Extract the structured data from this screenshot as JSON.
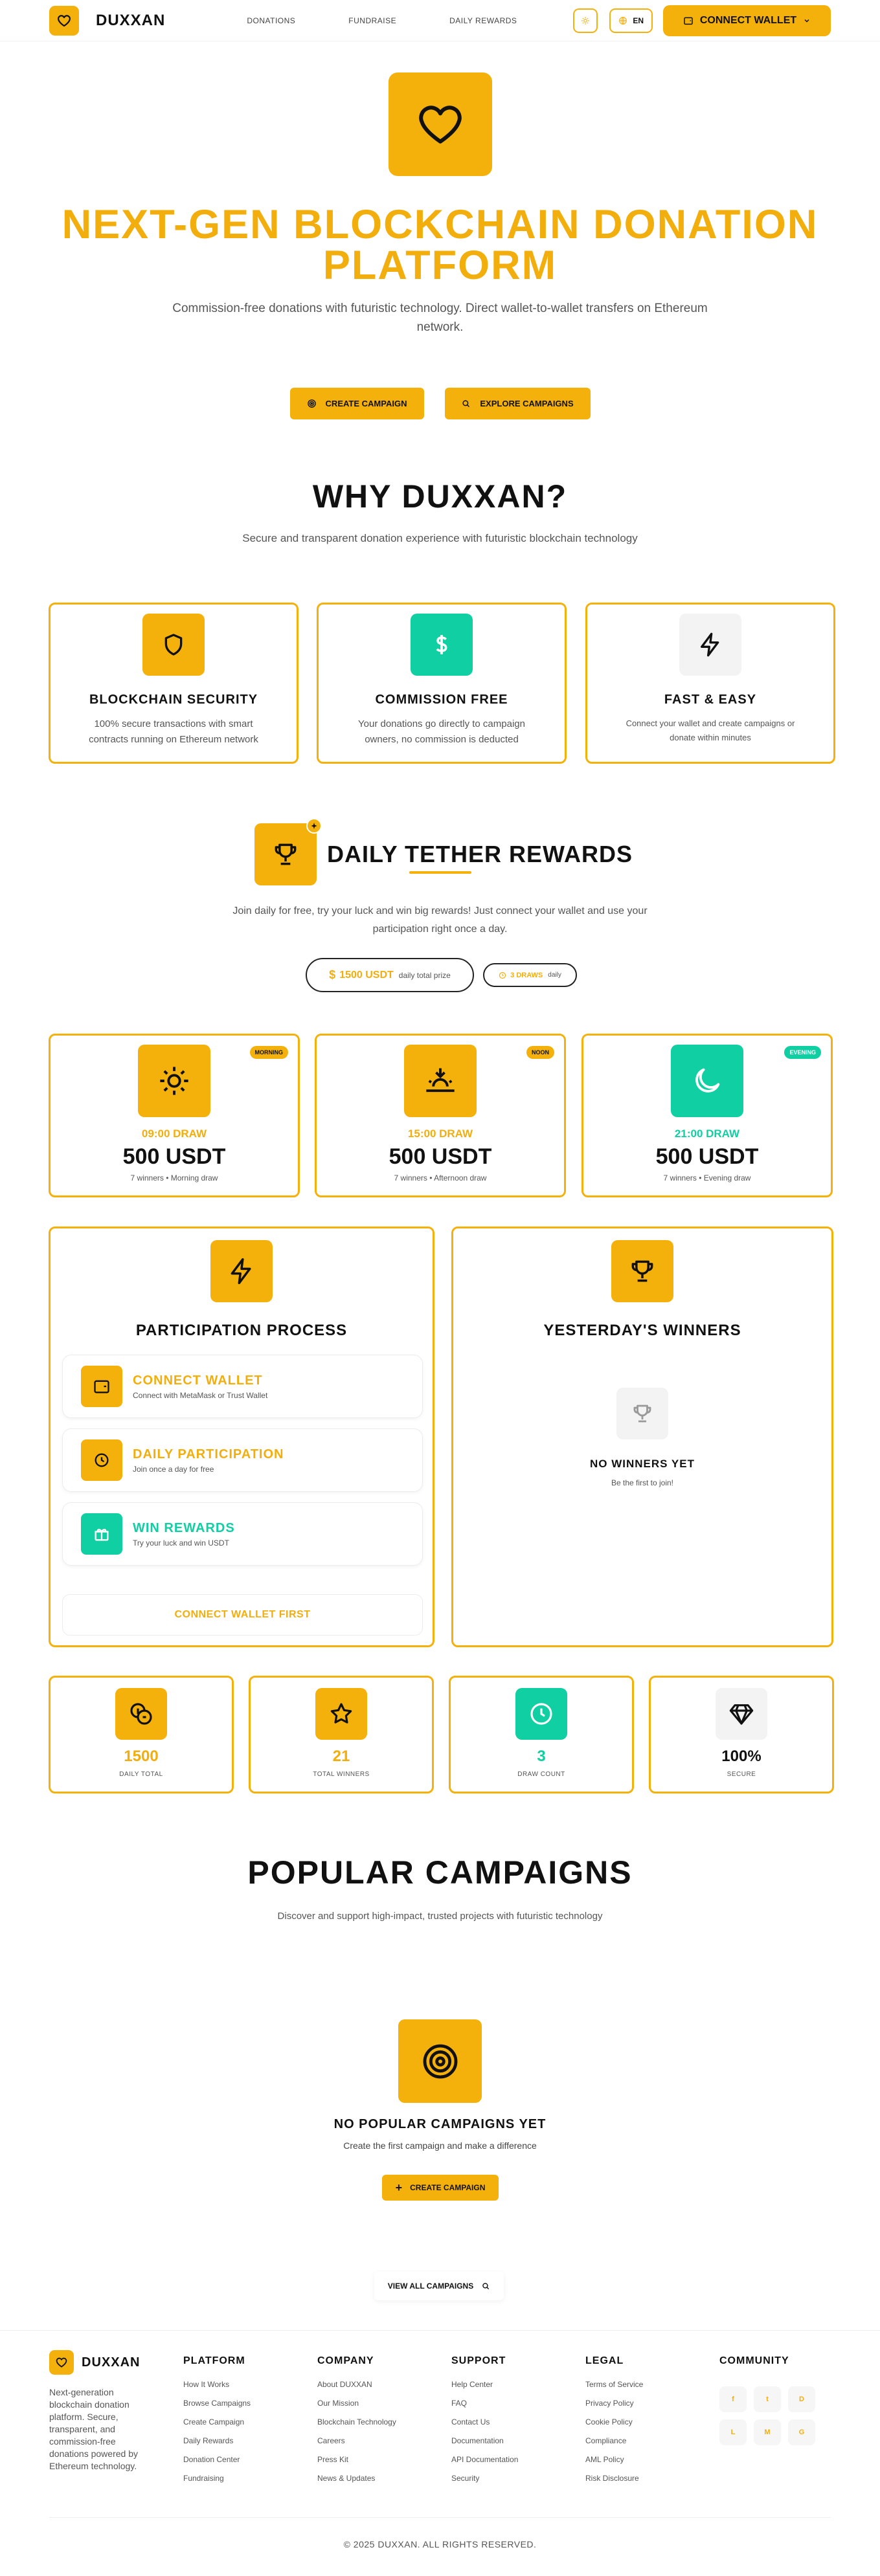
{
  "nav": {
    "brand": "DUXXAN",
    "links": [
      "DONATIONS",
      "FUNDRAISE",
      "DAILY REWARDS"
    ],
    "theme_icon": "sun-icon",
    "language": "EN",
    "connect_wallet": "CONNECT WALLET"
  },
  "hero": {
    "title": "NEXT-GEN BLOCKCHAIN DONATION PLATFORM",
    "subtitle": "Commission-free donations with futuristic technology. Direct wallet-to-wallet transfers on Ethereum network.",
    "create_campaign": "CREATE CAMPAIGN",
    "explore_campaigns": "EXPLORE CAMPAIGNS"
  },
  "why": {
    "title": "WHY DUXXAN?",
    "subtitle": "Secure and transparent donation experience with futuristic blockchain technology",
    "cards": [
      {
        "title": "BLOCKCHAIN SECURITY",
        "text": "100% secure transactions with smart contracts running on Ethereum network",
        "icon": "shield-icon"
      },
      {
        "title": "COMMISSION FREE",
        "text": "Your donations go directly to campaign owners, no commission is deducted",
        "icon": "dollar-icon"
      },
      {
        "title": "FAST & EASY",
        "text": "Connect your wallet and create campaigns or donate within minutes",
        "icon": "lightning-icon"
      }
    ]
  },
  "rewards": {
    "title": "DAILY TETHER REWARDS",
    "text": "Join daily for free, try your luck and win big rewards! Just connect your wallet and use your participation right once a day.",
    "prize_value": "1500 USDT",
    "prize_label": "daily total prize",
    "draws_value": "3 DRAWS",
    "draws_label": "daily",
    "draws": [
      {
        "badge": "MORNING",
        "time": "09:00 DRAW",
        "amount": "500 USDT",
        "sub": "7 winners • Morning draw",
        "icon": "sun-icon"
      },
      {
        "badge": "NOON",
        "time": "15:00 DRAW",
        "amount": "500 USDT",
        "sub": "7 winners • Afternoon draw",
        "icon": "sunset-icon"
      },
      {
        "badge": "EVENING",
        "time": "21:00 DRAW",
        "amount": "500 USDT",
        "sub": "7 winners • Evening draw",
        "icon": "moon-icon"
      }
    ],
    "process": {
      "title": "PARTICIPATION PROCESS",
      "steps": [
        {
          "title": "CONNECT WALLET",
          "sub": "Connect with MetaMask or Trust Wallet"
        },
        {
          "title": "DAILY PARTICIPATION",
          "sub": "Join once a day for free"
        },
        {
          "title": "WIN REWARDS",
          "sub": "Try your luck and win USDT"
        }
      ],
      "cta": "CONNECT WALLET FIRST"
    },
    "winners": {
      "title": "YESTERDAY'S WINNERS",
      "empty_title": "NO WINNERS YET",
      "empty_sub": "Be the first to join!"
    },
    "stats": [
      {
        "value": "1500",
        "label": "DAILY TOTAL",
        "icon": "coins-icon"
      },
      {
        "value": "21",
        "label": "TOTAL WINNERS",
        "icon": "star-icon"
      },
      {
        "value": "3",
        "label": "DRAW COUNT",
        "icon": "clock-icon"
      },
      {
        "value": "100%",
        "label": "SECURE",
        "icon": "diamond-icon"
      }
    ]
  },
  "campaigns": {
    "title": "POPULAR CAMPAIGNS",
    "subtitle": "Discover and support high-impact, trusted projects with futuristic technology",
    "empty_title": "NO POPULAR CAMPAIGNS YET",
    "empty_sub": "Create the first campaign and make a difference",
    "create": "CREATE CAMPAIGN",
    "view_all": "VIEW ALL CAMPAIGNS"
  },
  "footer": {
    "brand": "DUXXAN",
    "description": "Next-generation blockchain donation platform. Secure, transparent, and commission-free donations powered by Ethereum technology.",
    "columns": [
      {
        "title": "PLATFORM",
        "items": [
          "How It Works",
          "Browse Campaigns",
          "Create Campaign",
          "Daily Rewards",
          "Donation Center",
          "Fundraising"
        ]
      },
      {
        "title": "COMPANY",
        "items": [
          "About DUXXAN",
          "Our Mission",
          "Blockchain Technology",
          "Careers",
          "Press Kit",
          "News & Updates"
        ]
      },
      {
        "title": "SUPPORT",
        "items": [
          "Help Center",
          "FAQ",
          "Contact Us",
          "Documentation",
          "API Documentation",
          "Security"
        ]
      },
      {
        "title": "LEGAL",
        "items": [
          "Terms of Service",
          "Privacy Policy",
          "Cookie Policy",
          "Compliance",
          "AML Policy",
          "Risk Disclosure"
        ]
      }
    ],
    "community_title": "COMMUNITY",
    "social": [
      "f",
      "t",
      "D",
      "L",
      "M",
      "G"
    ],
    "copyright": "© 2025 DUXXAN. ALL RIGHTS RESERVED."
  }
}
